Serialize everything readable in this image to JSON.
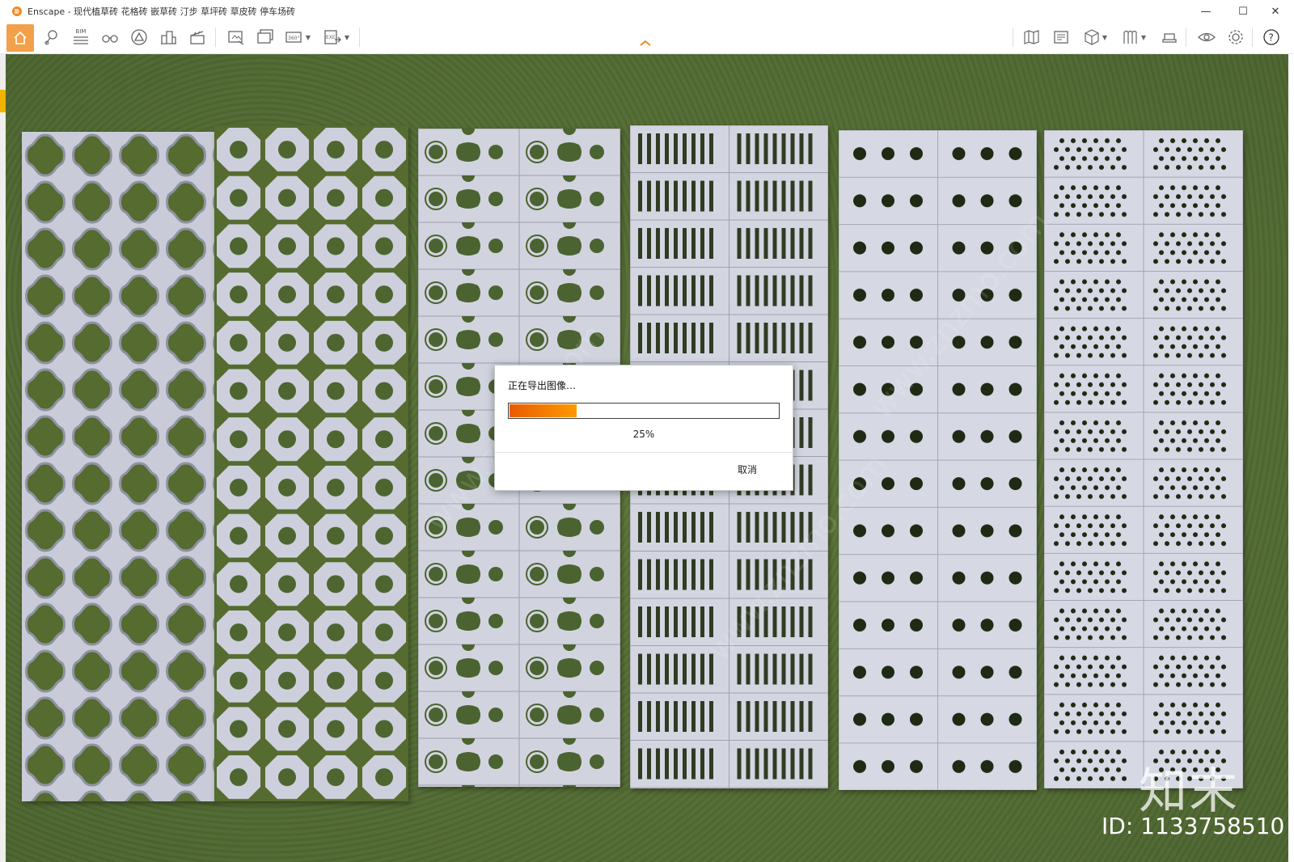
{
  "window": {
    "title": "Enscape - 现代植草砖 花格砖 嵌草砖 汀步 草坪砖 草皮砖 停车场砖",
    "brand_color": "#f08a24"
  },
  "toolbar": {
    "home_color": "#f2a04a",
    "bim_label": "BIM",
    "tools": [
      "home-icon",
      "pin-icon",
      "bim-icon",
      "binoculars-icon",
      "mountain-icon",
      "buildings-icon",
      "clapper-icon",
      "screenshot-icon",
      "batch-render-icon",
      "panorama-icon",
      "export-exe-icon",
      "map-icon",
      "asset-library-icon",
      "cube-icon",
      "material-icon",
      "hat-icon",
      "eye-icon",
      "gear-icon",
      "help-icon"
    ]
  },
  "dialog": {
    "title": "正在导出图像…",
    "progress": 0.25,
    "progress_label": "25%",
    "cancel_label": "取消",
    "progress_colors": [
      "#e85b00",
      "#ff9a00"
    ]
  },
  "watermark": {
    "logo_text": "知末",
    "id_text": "ID: 1133758510",
    "url_text": "www.znzmo.com"
  }
}
